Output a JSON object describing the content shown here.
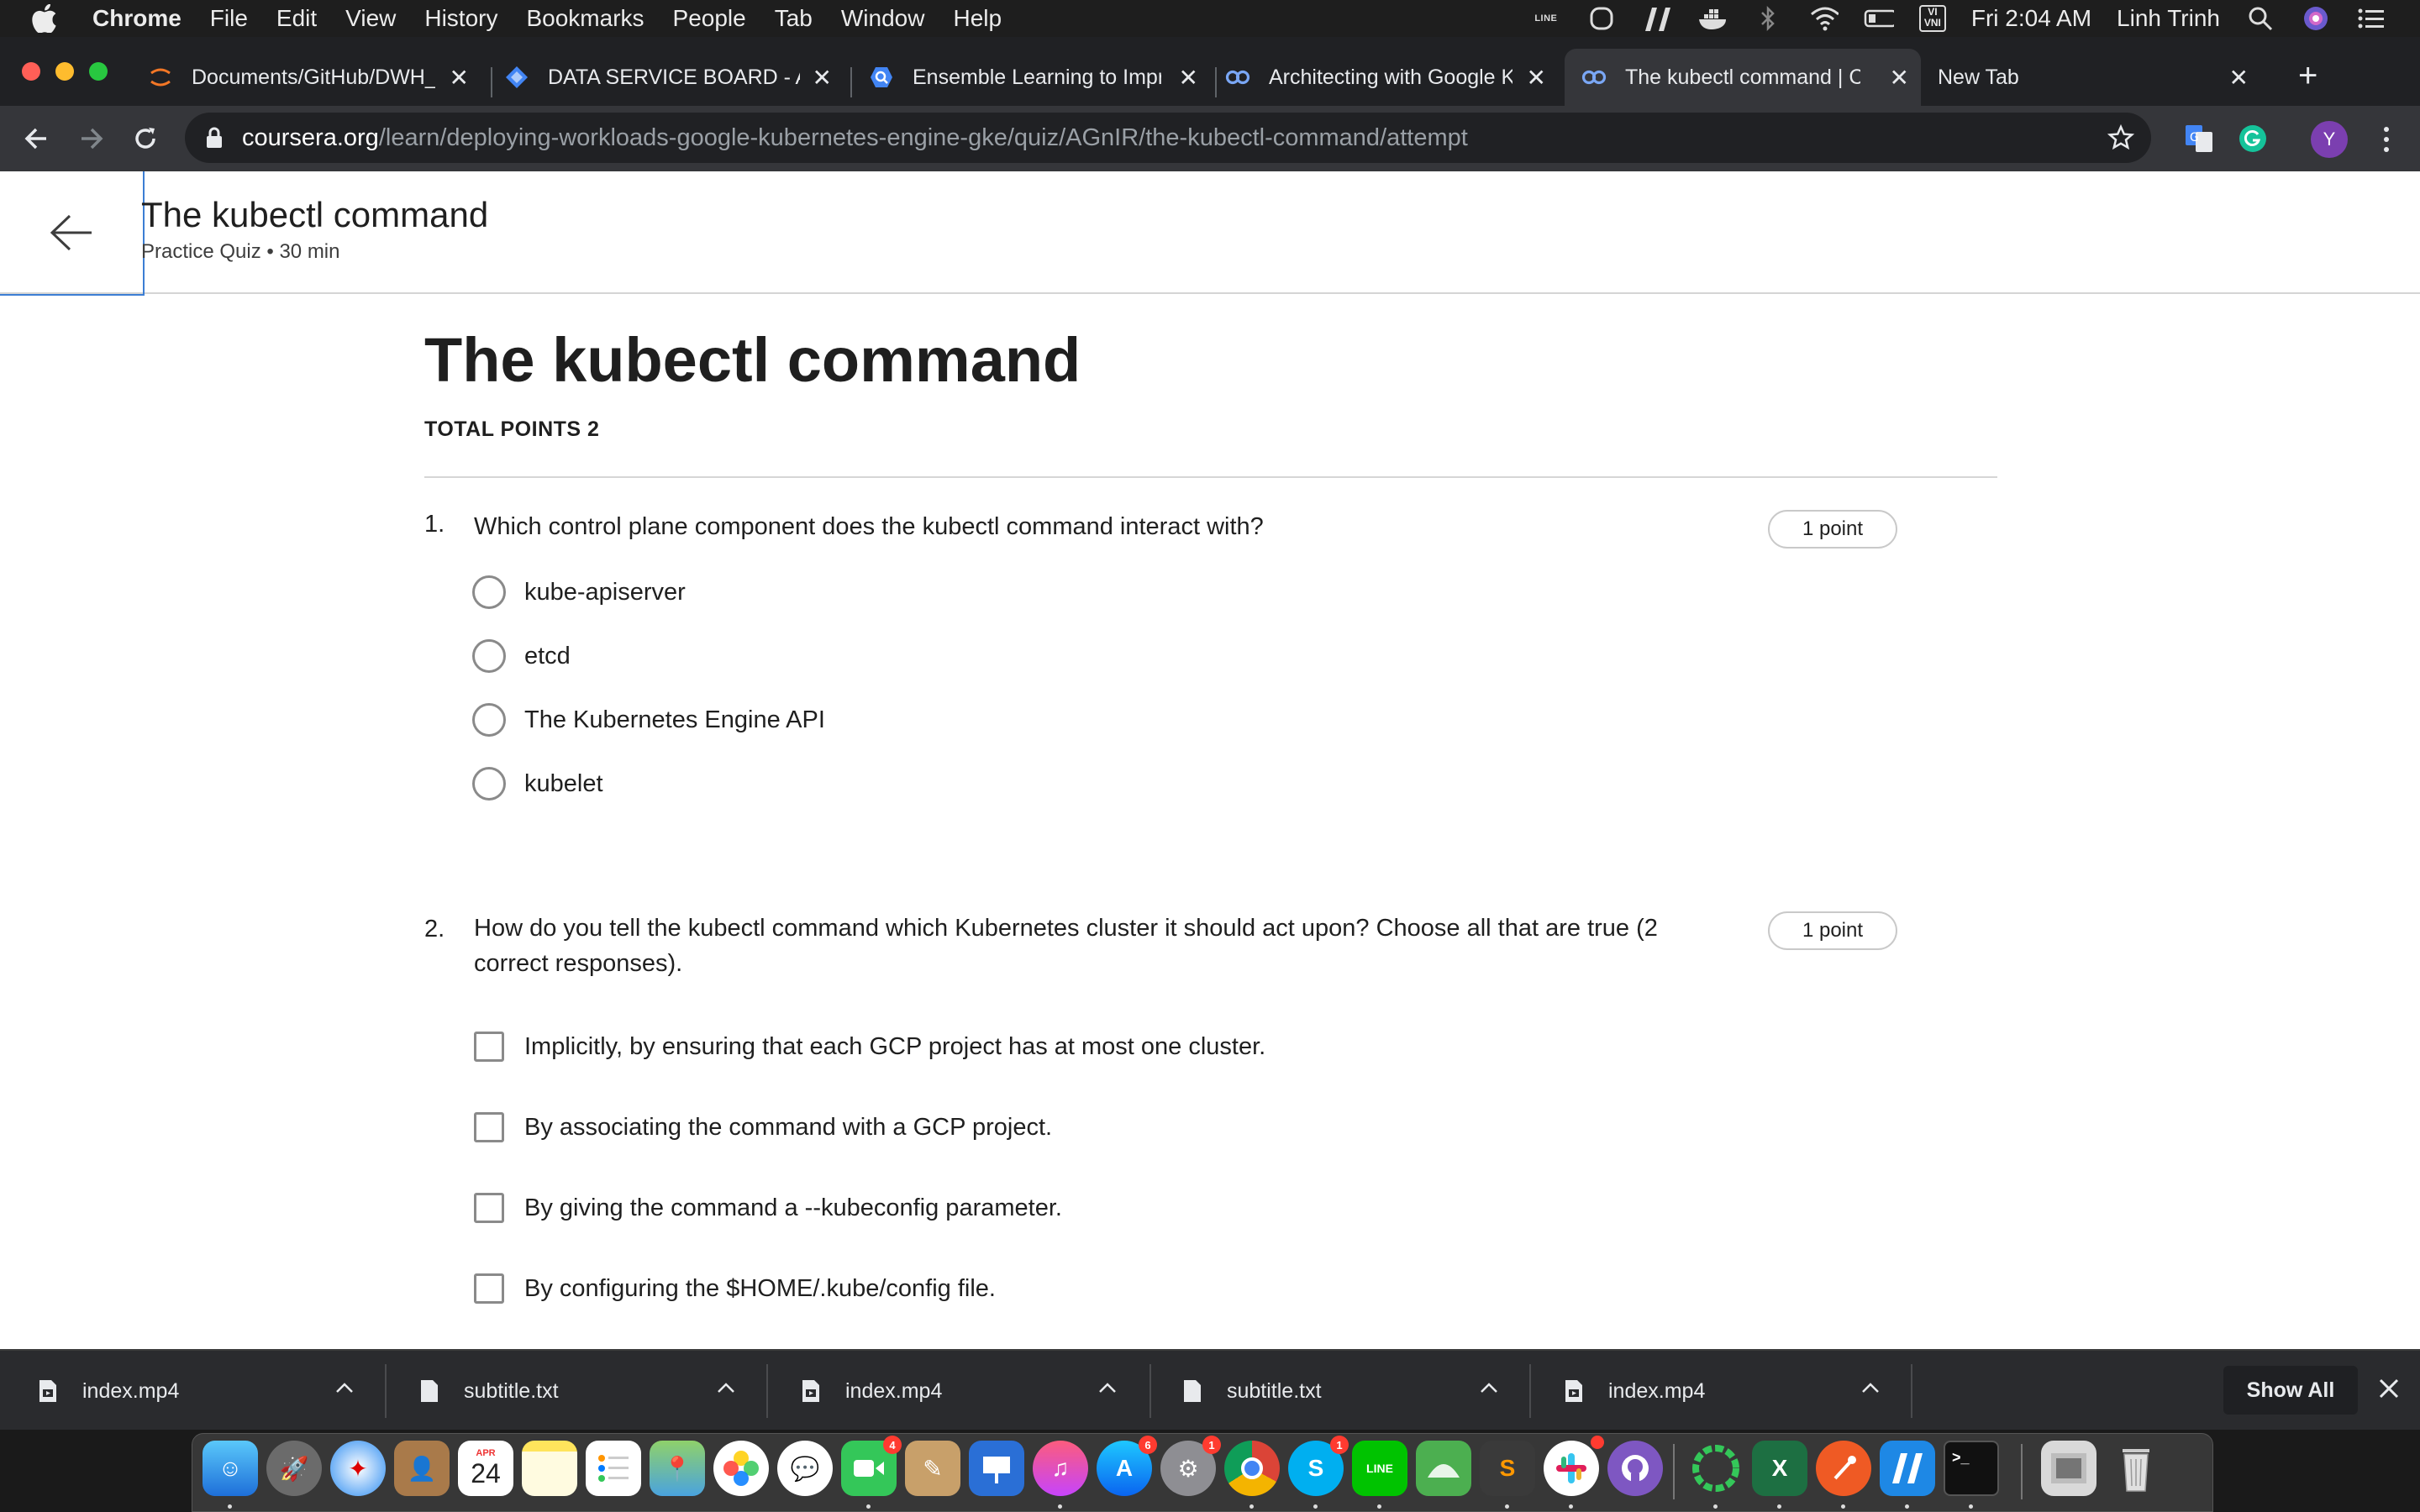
{
  "menubar": {
    "app_name": "Chrome",
    "items": [
      "File",
      "Edit",
      "View",
      "History",
      "Bookmarks",
      "People",
      "Tab",
      "Window",
      "Help"
    ],
    "status_line_label": "LINE",
    "input_method": "VI\nVNI",
    "clock": "Fri 2:04 AM",
    "user": "Linh Trinh"
  },
  "tabs": [
    {
      "title": "Documents/GitHub/DWH_",
      "favicon": "jupyter-icon",
      "active": false
    },
    {
      "title": "DATA SERVICE BOARD - A",
      "favicon": "datastudio-icon",
      "active": false
    },
    {
      "title": "Ensemble Learning to Impr",
      "favicon": "bigquery-icon",
      "active": false
    },
    {
      "title": "Architecting with Google K",
      "favicon": "coursera-icon",
      "active": false
    },
    {
      "title": "The kubectl command | Cou",
      "favicon": "coursera-icon",
      "active": true
    },
    {
      "title": "New Tab",
      "favicon": "",
      "active": false
    }
  ],
  "address_bar": {
    "host": "coursera.org",
    "path": "/learn/deploying-workloads-google-kubernetes-engine-gke/quiz/AGnIR/the-kubectl-command/attempt"
  },
  "profile_initial": "Y",
  "page_header": {
    "title": "The kubectl command",
    "subtitle": "Practice Quiz • 30 min"
  },
  "quiz": {
    "title": "The kubectl command",
    "total_points": "TOTAL POINTS 2",
    "questions": [
      {
        "number": "1.",
        "text": "Which control plane component does the kubectl command interact with?",
        "points": "1 point",
        "input_type": "radio",
        "options": [
          "kube-apiserver",
          "etcd",
          "The Kubernetes Engine API",
          "kubelet"
        ]
      },
      {
        "number": "2.",
        "text": "How do you tell the kubectl command which Kubernetes cluster it should act upon? Choose all that are true (2 correct responses).",
        "points": "1 point",
        "input_type": "checkbox",
        "options": [
          "Implicitly, by ensuring that each GCP project has at most one cluster.",
          "By associating the command with a GCP project.",
          "By giving the command a --kubeconfig parameter.",
          "By configuring the $HOME/.kube/config file."
        ]
      }
    ]
  },
  "downloads": {
    "items": [
      "index.mp4",
      "subtitle.txt",
      "index.mp4",
      "subtitle.txt",
      "index.mp4"
    ],
    "show_all_label": "Show All"
  },
  "dock": {
    "calendar_month": "APR",
    "calendar_day": "24",
    "badges": {
      "facetime": "4",
      "appstore": "6",
      "sysprefs": "1",
      "skype": "1"
    },
    "colors": {
      "accent_purple": "#7b3fb0",
      "chrome_dark": "#202124",
      "chrome_toolbar": "#35363a"
    }
  }
}
